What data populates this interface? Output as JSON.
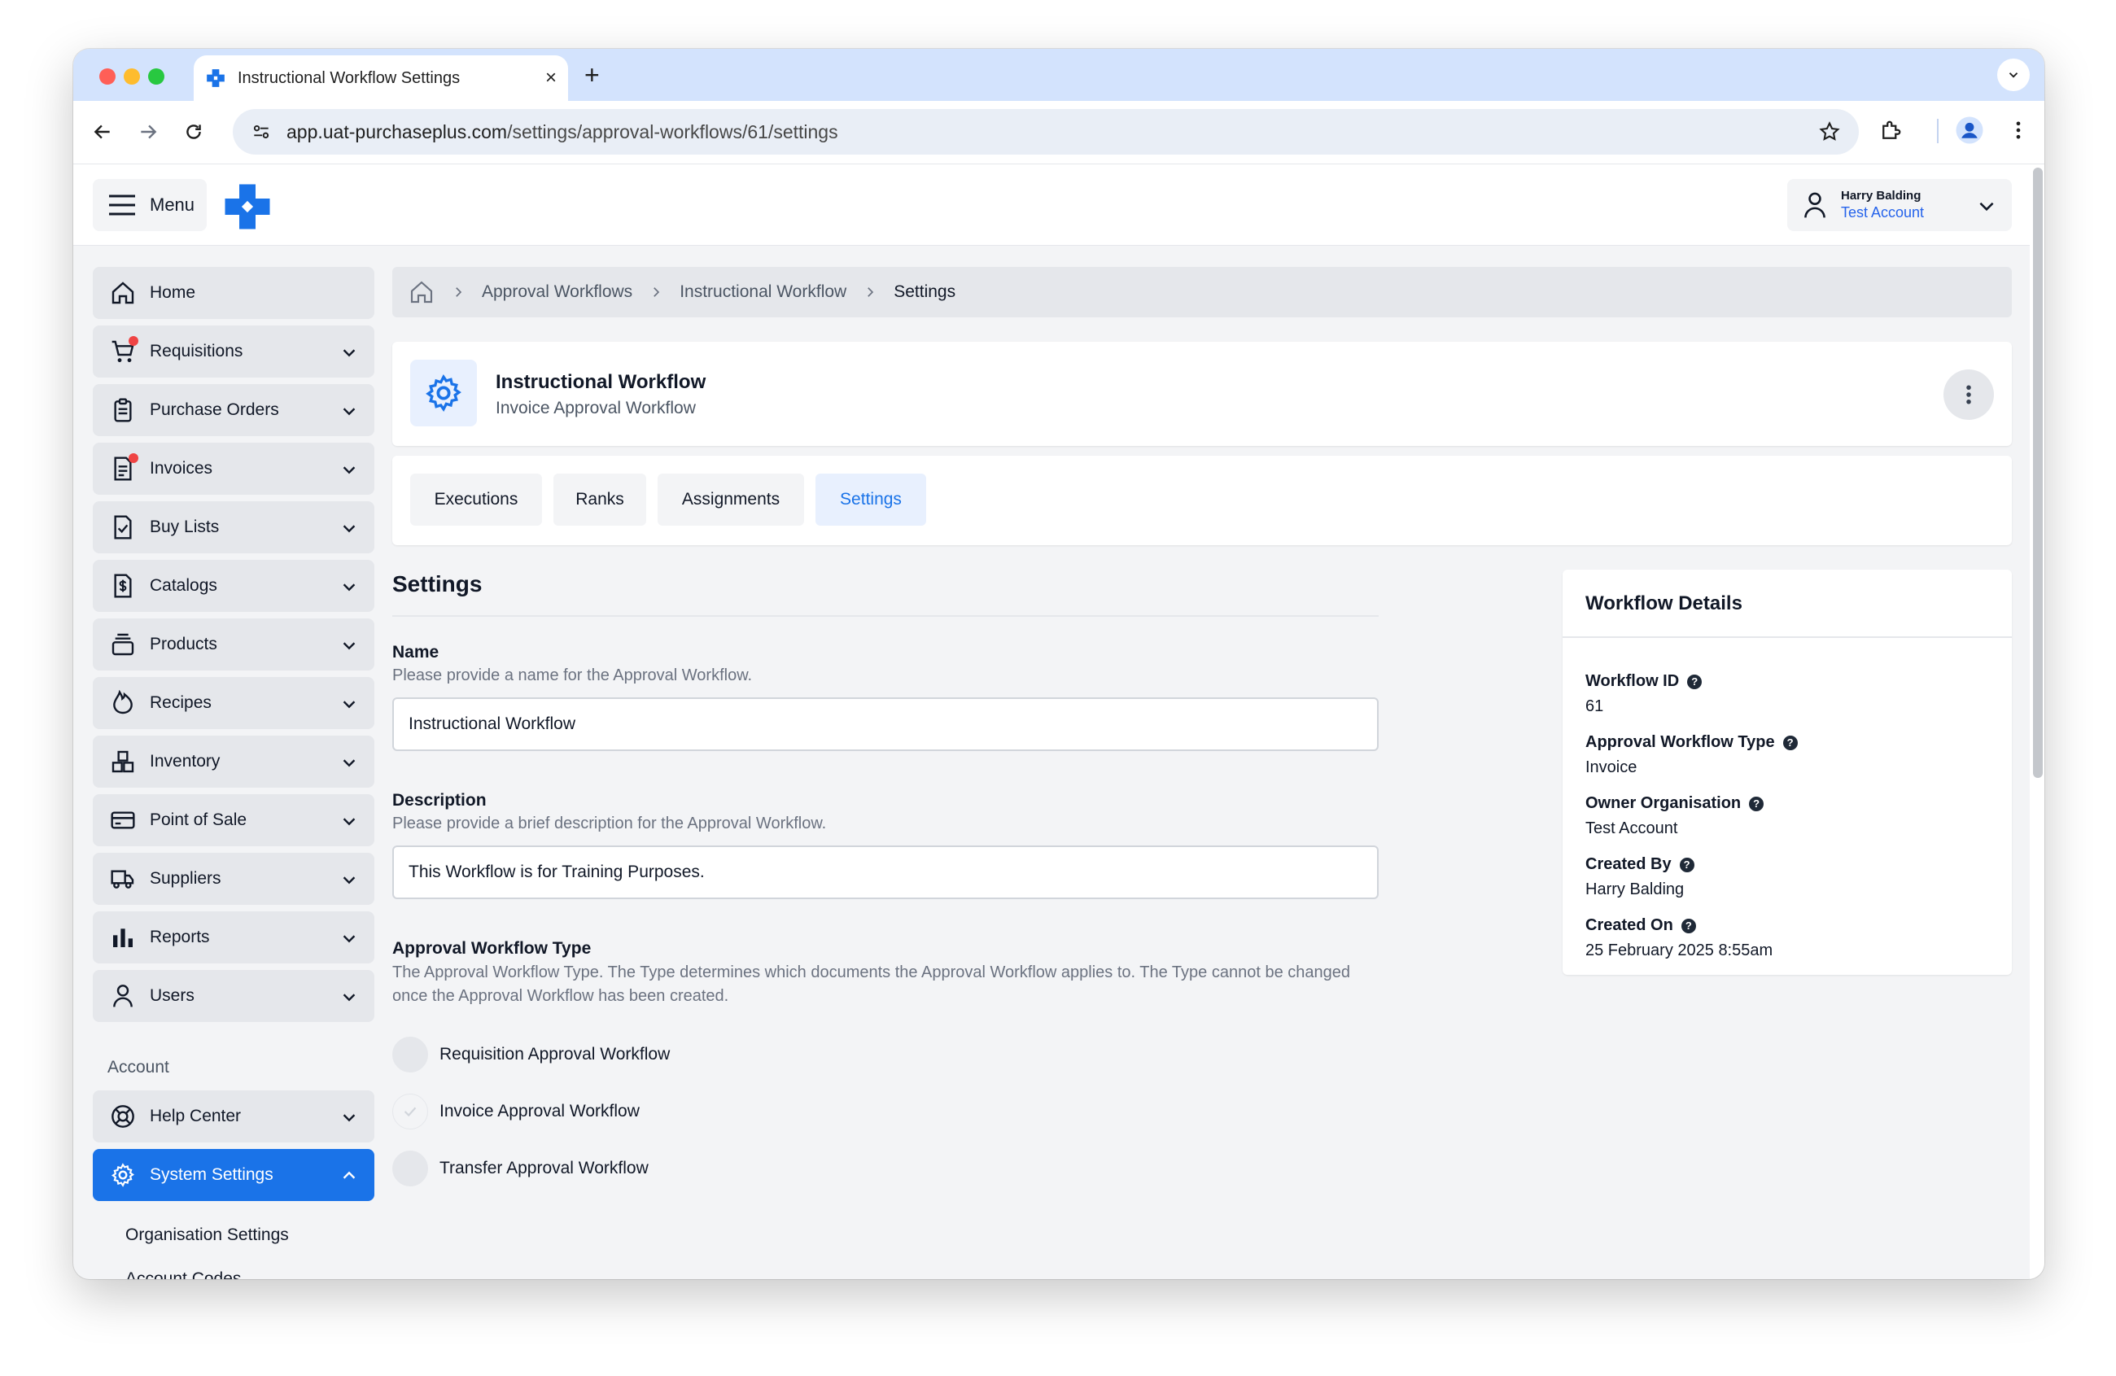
{
  "browser": {
    "tab_title": "Instructional Workflow Settings",
    "tab_close": "×",
    "new_tab": "+",
    "url_host": "app.uat-purchaseplus.com",
    "url_path": "/settings/approval-workflows/61/settings"
  },
  "header": {
    "menu_label": "Menu",
    "user_name": "Harry Balding",
    "user_account": "Test Account"
  },
  "sidebar": {
    "items": [
      {
        "label": "Home",
        "icon": "home-icon"
      },
      {
        "label": "Requisitions",
        "icon": "cart-icon",
        "badge": true
      },
      {
        "label": "Purchase Orders",
        "icon": "clipboard-icon"
      },
      {
        "label": "Invoices",
        "icon": "invoice-icon",
        "badge": true
      },
      {
        "label": "Buy Lists",
        "icon": "checklist-icon"
      },
      {
        "label": "Catalogs",
        "icon": "dollar-doc-icon"
      },
      {
        "label": "Products",
        "icon": "stack-icon"
      },
      {
        "label": "Recipes",
        "icon": "flame-icon"
      },
      {
        "label": "Inventory",
        "icon": "boxes-icon"
      },
      {
        "label": "Point of Sale",
        "icon": "card-icon"
      },
      {
        "label": "Suppliers",
        "icon": "truck-icon"
      },
      {
        "label": "Reports",
        "icon": "bar-chart-icon"
      },
      {
        "label": "Users",
        "icon": "user-icon"
      }
    ],
    "section_label": "Account",
    "help_center": "Help Center",
    "system_settings": "System Settings",
    "sub_items": [
      "Organisation Settings",
      "Account Codes"
    ]
  },
  "breadcrumb": {
    "items": [
      "Approval Workflows",
      "Instructional Workflow"
    ],
    "current": "Settings"
  },
  "title": {
    "main": "Instructional Workflow",
    "sub": "Invoice Approval Workflow"
  },
  "tabs": [
    "Executions",
    "Ranks",
    "Assignments",
    "Settings"
  ],
  "active_tab": "Settings",
  "settings": {
    "heading": "Settings",
    "name_label": "Name",
    "name_help": "Please provide a name for the Approval Workflow.",
    "name_value": "Instructional Workflow",
    "description_label": "Description",
    "description_help": "Please provide a brief description for the Approval Workflow.",
    "description_value": "This Workflow is for Training Purposes.",
    "type_label": "Approval Workflow Type",
    "type_help": "The Approval Workflow Type. The Type determines which documents the Approval Workflow applies to. The Type cannot be changed once the Approval Workflow has been created.",
    "type_options": [
      "Requisition Approval Workflow",
      "Invoice Approval Workflow",
      "Transfer Approval Workflow"
    ],
    "type_selected": "Invoice Approval Workflow"
  },
  "details": {
    "heading": "Workflow Details",
    "fields": [
      {
        "label": "Workflow ID",
        "value": "61"
      },
      {
        "label": "Approval Workflow Type",
        "value": "Invoice"
      },
      {
        "label": "Owner Organisation",
        "value": "Test Account"
      },
      {
        "label": "Created By",
        "value": "Harry Balding"
      },
      {
        "label": "Created On",
        "value": "25 February 2025 8:55am"
      }
    ],
    "help_glyph": "?"
  },
  "colors": {
    "accent": "#1a73e8",
    "badge": "#ef4444",
    "chrome_tabbar": "#d3e3fd"
  }
}
